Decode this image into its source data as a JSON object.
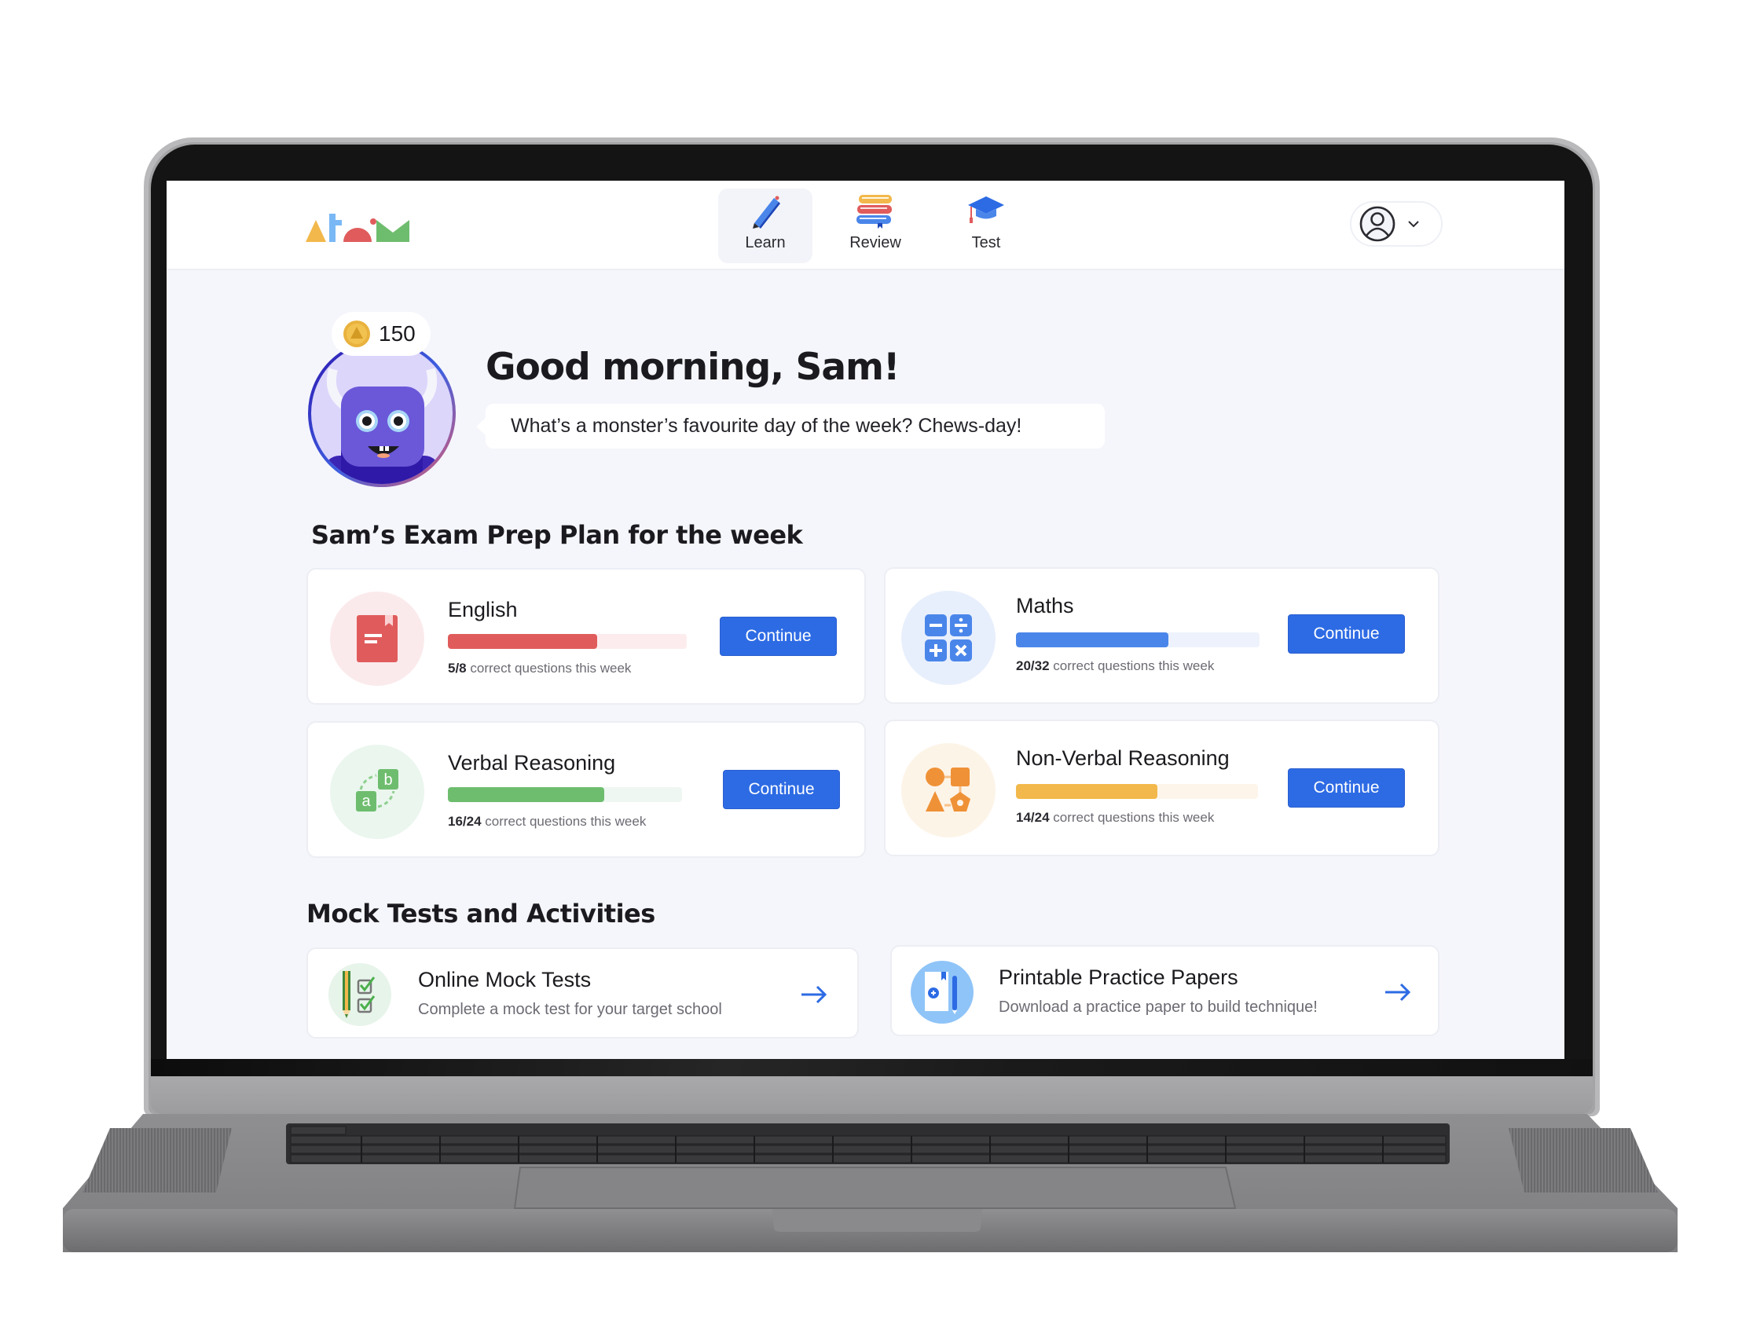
{
  "app": {
    "logo_alt": "atom",
    "nav": [
      {
        "label": "Learn",
        "icon": "pencil-icon",
        "active": true
      },
      {
        "label": "Review",
        "icon": "books-icon",
        "active": false
      },
      {
        "label": "Test",
        "icon": "graduation-cap-icon",
        "active": false
      }
    ],
    "profile": {
      "icon": "user-circle-icon",
      "chevron": "chevron-down-icon"
    }
  },
  "greeting": {
    "coins": "150",
    "title": "Good morning, Sam!",
    "joke": "What’s a monster’s favourite day of the week? Chews-day!"
  },
  "plan": {
    "title": "Sam’s Exam Prep Plan for the week",
    "subjects": [
      {
        "name": "English",
        "correct": 5,
        "total": 8,
        "score": "5/8",
        "caption": "correct questions this week",
        "button": "Continue",
        "color": "#e05c5c",
        "track": "#fdecee",
        "icon_bg": "#fbeaec",
        "icon": "book-icon"
      },
      {
        "name": "Maths",
        "correct": 20,
        "total": 32,
        "score": "20/32",
        "caption": "correct questions this week",
        "button": "Continue",
        "color": "#4a86ea",
        "track": "#edf2fc",
        "icon_bg": "#e8effc",
        "icon": "calculator-icon"
      },
      {
        "name": "Verbal Reasoning",
        "correct": 16,
        "total": 24,
        "score": "16/24",
        "caption": "correct questions this week",
        "button": "Continue",
        "color": "#6ebd6e",
        "track": "#eef7f1",
        "icon_bg": "#eaf6ee",
        "icon": "letters-ab-icon"
      },
      {
        "name": "Non-Verbal Reasoning",
        "correct": 14,
        "total": 24,
        "score": "14/24",
        "caption": "correct questions this week",
        "button": "Continue",
        "color": "#f2b84b",
        "track": "#fdf5ea",
        "icon_bg": "#fdf4e8",
        "icon": "shapes-icon"
      }
    ]
  },
  "activities": {
    "title": "Mock Tests and Activities",
    "items": [
      {
        "title": "Online Mock Tests",
        "subtitle": "Complete a mock test for your target school",
        "icon": "checklist-pencil-icon"
      },
      {
        "title": "Printable Practice Papers",
        "subtitle": "Download a practice paper to build technique!",
        "icon": "printable-paper-icon"
      }
    ]
  },
  "colors": {
    "accent": "#2d6be4",
    "background": "#f5f6fb"
  }
}
